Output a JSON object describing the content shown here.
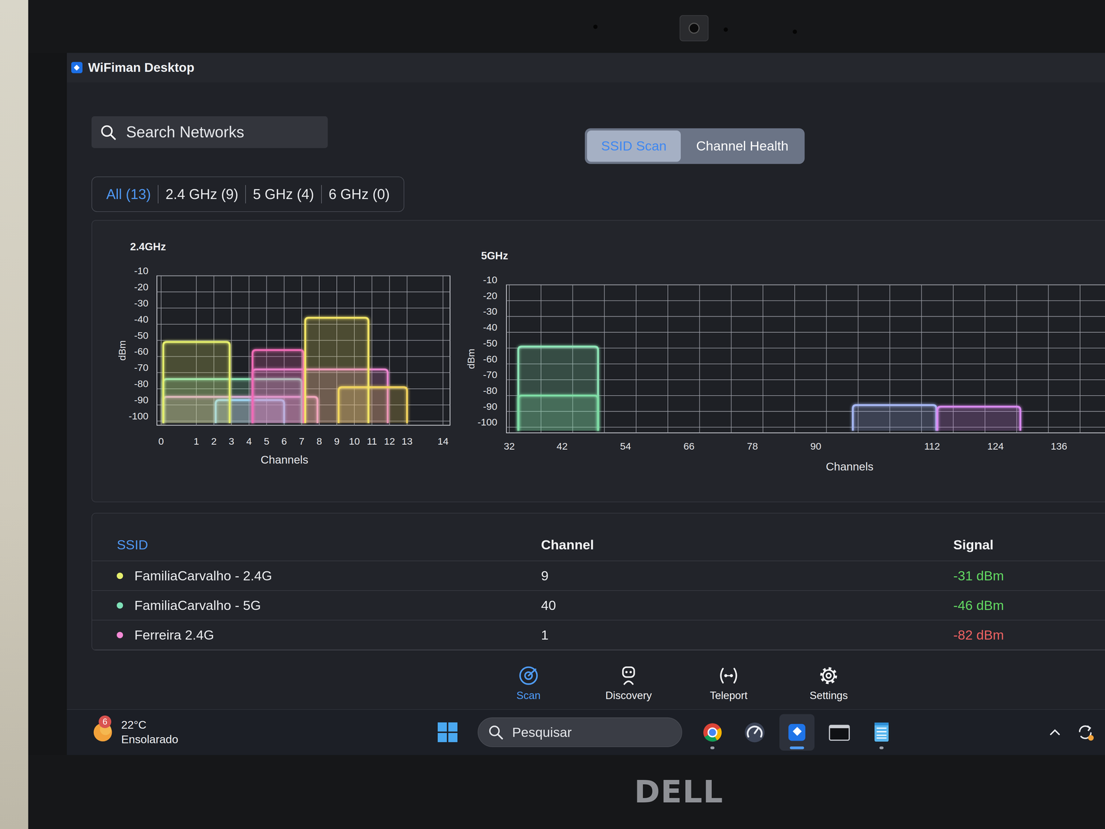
{
  "window": {
    "title": "WiFiman Desktop"
  },
  "search": {
    "placeholder": "Search Networks"
  },
  "view_tabs": [
    {
      "label": "SSID Scan",
      "selected": true
    },
    {
      "label": "Channel Health",
      "selected": false
    }
  ],
  "band_filters": [
    {
      "label": "All (13)",
      "selected": true
    },
    {
      "label": "2.4 GHz (9)",
      "selected": false
    },
    {
      "label": "5 GHz (4)",
      "selected": false
    },
    {
      "label": "6 GHz (0)",
      "selected": false
    }
  ],
  "charts": [
    {
      "title": "2.4GHz",
      "y_label": "dBm",
      "x_label": "Channels",
      "y_ticks": [
        "-10",
        "-20",
        "-30",
        "-40",
        "-50",
        "-60",
        "-70",
        "-80",
        "-90",
        "-100"
      ],
      "x_ticks": [
        "0",
        "1",
        "2",
        "3",
        "4",
        "5",
        "6",
        "7",
        "8",
        "9",
        "10",
        "11",
        "12",
        "13",
        "14"
      ],
      "series": [
        {
          "from": 0.06,
          "to": 7.9,
          "dbm": -85,
          "color": "#f29ad8"
        },
        {
          "from": 0.06,
          "to": 7.0,
          "dbm": -74,
          "color": "#8fe6b8"
        },
        {
          "from": 2.1,
          "to": 6.0,
          "dbm": -87,
          "color": "#9fd6f2"
        },
        {
          "from": 4.2,
          "to": 11.9,
          "dbm": -68,
          "color": "#ea86cf"
        },
        {
          "from": 4.2,
          "to": 7.1,
          "dbm": -56,
          "color": "#f06bb6"
        },
        {
          "from": 9.1,
          "to": 13.0,
          "dbm": -79,
          "color": "#f2d35e"
        },
        {
          "from": 0.06,
          "to": 2.9,
          "dbm": -51,
          "color": "#e6ef6e"
        },
        {
          "from": 7.2,
          "to": 10.8,
          "dbm": -36,
          "color": "#f3e566"
        }
      ]
    },
    {
      "title": "5GHz",
      "y_label": "dBm",
      "x_label": "Channels",
      "y_ticks": [
        "-10",
        "-20",
        "-30",
        "-40",
        "-50",
        "-60",
        "-70",
        "-80",
        "-90",
        "-100"
      ],
      "x_ticks": [
        "32",
        "42",
        "54",
        "66",
        "78",
        "90",
        "112",
        "124",
        "136"
      ],
      "series": [
        {
          "from": 33.7,
          "to": 48.8,
          "dbm": -49,
          "color": "#8fe6b8"
        },
        {
          "from": 33.7,
          "to": 48.8,
          "dbm": -80,
          "color": "#7fdfa6"
        },
        {
          "from": 97.0,
          "to": 112.8,
          "dbm": -86,
          "color": "#a7b8f5"
        },
        {
          "from": 113.0,
          "to": 128.7,
          "dbm": -87,
          "color": "#d98af0"
        }
      ]
    }
  ],
  "table": {
    "columns": [
      {
        "label": "SSID",
        "selected": true
      },
      {
        "label": "Channel",
        "selected": false
      },
      {
        "label": "Signal",
        "selected": false
      }
    ],
    "rows": [
      {
        "ssid": "FamiliaCarvalho - 2.4G",
        "channel": "9",
        "signal": "-31 dBm",
        "color": "#e6ef6e",
        "signal_color": "#62d962"
      },
      {
        "ssid": "FamiliaCarvalho - 5G",
        "channel": "40",
        "signal": "-46 dBm",
        "color": "#7fe0b8",
        "signal_color": "#62d962"
      },
      {
        "ssid": "Ferreira 2.4G",
        "channel": "1",
        "signal": "-82 dBm",
        "color": "#f58ad6",
        "signal_color": "#f06262"
      }
    ]
  },
  "nav": [
    {
      "label": "Scan",
      "kind": "scan",
      "selected": true
    },
    {
      "label": "Discovery",
      "kind": "discovery",
      "selected": false
    },
    {
      "label": "Teleport",
      "kind": "teleport",
      "selected": false
    },
    {
      "label": "Settings",
      "kind": "settings",
      "selected": false
    }
  ],
  "taskbar": {
    "weather": {
      "badge": "6",
      "temperature": "22°C",
      "condition": "Ensolarado"
    },
    "search": {
      "placeholder": "Pesquisar"
    },
    "apps": [
      {
        "kind": "chrome",
        "running": true,
        "active": false
      },
      {
        "kind": "gauge",
        "running": false,
        "active": false
      },
      {
        "kind": "wifiman",
        "running": true,
        "active": true
      },
      {
        "kind": "terminal",
        "running": false,
        "active": false
      },
      {
        "kind": "notepad",
        "running": true,
        "active": false
      }
    ]
  },
  "brand": "DELL"
}
